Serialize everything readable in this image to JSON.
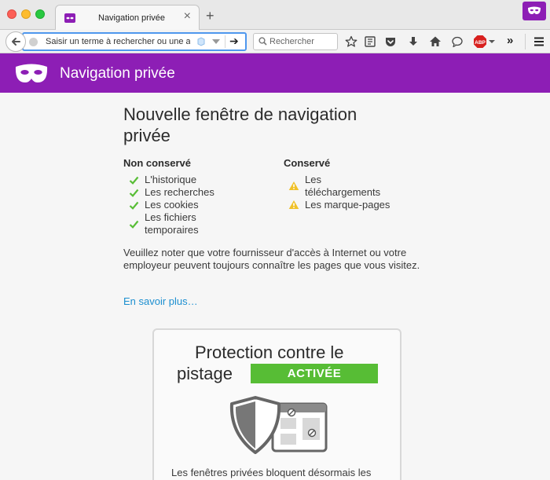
{
  "window": {
    "tab_title": "Navigation privée"
  },
  "toolbar": {
    "url_placeholder": "Saisir un terme à rechercher ou une adresse",
    "search_placeholder": "Rechercher",
    "abp_label": "ABP",
    "overflow_label": "»"
  },
  "header": {
    "title": "Navigation privée"
  },
  "content": {
    "title": "Nouvelle fenêtre de navigation privée",
    "not_saved": {
      "heading": "Non conservé",
      "items": [
        "L'historique",
        "Les recherches",
        "Les cookies",
        "Les fichiers temporaires"
      ]
    },
    "saved": {
      "heading": "Conservé",
      "items": [
        "Les téléchargements",
        "Les marque-pages"
      ]
    },
    "note": "Veuillez noter que votre fournisseur d'accès à Internet ou votre employeur peuvent toujours connaître les pages que vous visitez.",
    "learn_more": "En savoir plus…"
  },
  "tracking": {
    "title_line1": "Protection contre le",
    "title_line2": "pistage",
    "badge": "ACTIVÉE",
    "text": "Les fenêtres privées bloquent désormais les"
  },
  "colors": {
    "accent_purple": "#8d1eb5",
    "check_green": "#57bd35",
    "warning_yellow": "#f0c129",
    "link_blue": "#1c8fd0",
    "url_focus": "#4e97ee"
  }
}
